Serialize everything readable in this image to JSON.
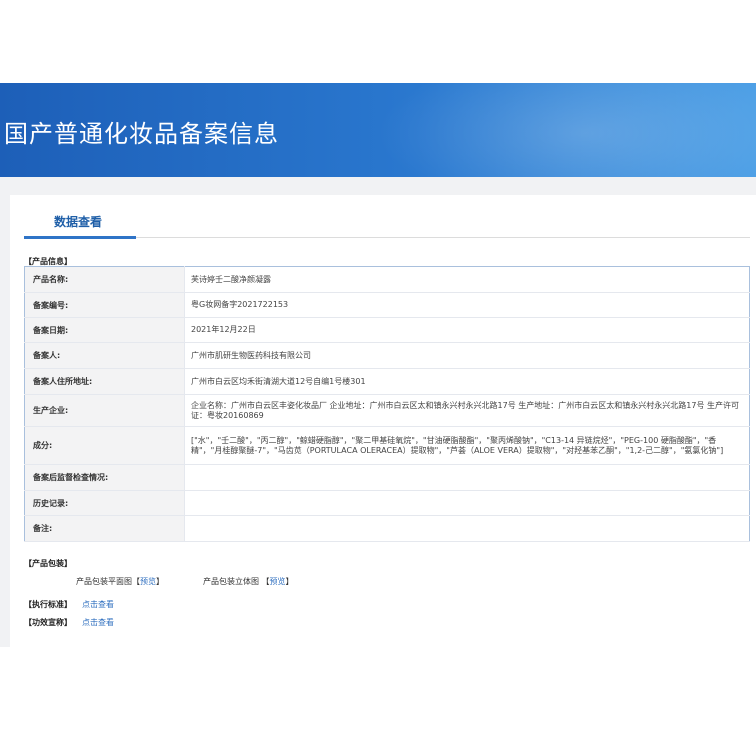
{
  "header": {
    "title": "国产普通化妆品备案信息"
  },
  "tabs": [
    {
      "label": "数据查看",
      "active": true
    }
  ],
  "product_info": {
    "section_title": "【产品信息】",
    "rows": [
      {
        "label": "产品名称:",
        "value": "芙诗婷壬二酸净颜凝露"
      },
      {
        "label": "备案编号:",
        "value": "粤G妆网备字2021722153"
      },
      {
        "label": "备案日期:",
        "value": "2021年12月22日"
      },
      {
        "label": "备案人:",
        "value": "广州市肌研生物医药科技有限公司"
      },
      {
        "label": "备案人住所地址:",
        "value": "广州市白云区均禾街清湖大道12号自编1号楼301"
      },
      {
        "label": "生产企业:",
        "value": "企业名称：广州市白云区丰姿化妆品厂 企业地址：广州市白云区太和镇永兴村永兴北路17号 生产地址：广州市白云区太和镇永兴村永兴北路17号 生产许可证：粤妆20160869"
      },
      {
        "label": "成分:",
        "value": "[\"水\"，\"壬二酸\"，\"丙二醇\"，\"鲸蜡硬脂醇\"，\"聚二甲基硅氧烷\"，\"甘油硬脂酸酯\"，\"聚丙烯酸钠\"，\"C13-14 异链烷烃\"，\"PEG-100 硬脂酸酯\"，\"香精\"，\"月桂醇聚醚-7\"，\"马齿苋（PORTULACA OLERACEA）提取物\"，\"芦荟（ALOE VERA）提取物\"，\"对羟基苯乙酮\"，\"1,2-己二醇\"，\"氨氯化钠\"]"
      },
      {
        "label": "备案后监督检查情况:",
        "value": ""
      },
      {
        "label": "历史记录:",
        "value": ""
      },
      {
        "label": "备注:",
        "value": ""
      }
    ]
  },
  "packaging": {
    "section_title": "【产品包装】",
    "flat_label": "产品包装平面图",
    "stereo_label": "产品包装立体图",
    "preview_text": "预览",
    "bracket_open": "【",
    "bracket_close": "】"
  },
  "standard": {
    "section_title": "【执行标准】",
    "link": "点击查看"
  },
  "efficacy": {
    "section_title": "【功效宣称】",
    "link": "点击查看"
  },
  "colors": {
    "banner_start": "#1d5fb8",
    "banner_end": "#4ea0e6",
    "tab_accent": "#2f74c7",
    "link": "#2f6fbf",
    "table_border": "#a9c0dd",
    "label_bg": "#f3f3f4"
  }
}
